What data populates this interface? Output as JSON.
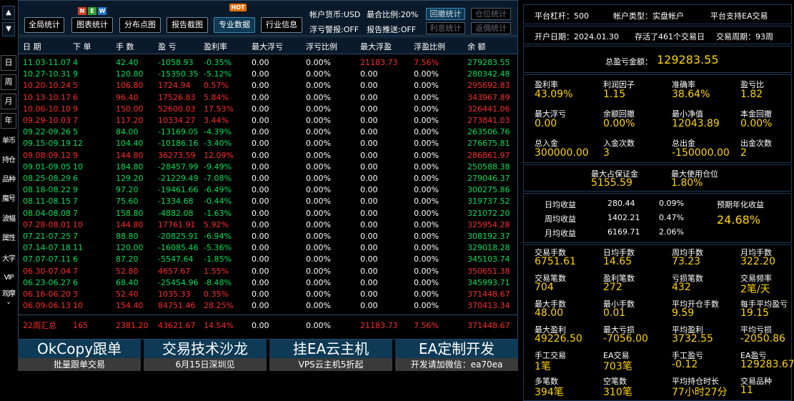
{
  "nav": {
    "up_arrow": "▲",
    "down_arrow": "▼",
    "side": [
      "日",
      "周",
      "月",
      "年",
      "单币",
      "持仓",
      "品种",
      "魔号",
      "波幅",
      "属性",
      "大字",
      "VIP",
      "观摩",
      "˅"
    ]
  },
  "toolbar": {
    "buttons": [
      "全局统计",
      "图表统计",
      "分布点图",
      "报告截图",
      "专业数据",
      "行业信息"
    ],
    "badges": [
      "N",
      "E",
      "W"
    ],
    "hot_badge": "HOT",
    "currency": "帐户货币:USD",
    "max_ratio": "最合比例:20%",
    "float_alert": "浮亏警报:OFF",
    "report_push": "报告推送:OFF",
    "btn_drawdown": "回撤统计",
    "btn_position": "仓位统计",
    "btn_interest": "利息统计",
    "btn_rebate": "返佣统计"
  },
  "table": {
    "headers": [
      "日 期",
      "下 单",
      "手 数",
      "盈 亏",
      "盈利率",
      "最大浮亏",
      "浮亏比例",
      "最大浮盈",
      "浮盈比例",
      "余 额"
    ],
    "rows": [
      {
        "c": "green",
        "d": [
          "11.03-11.07",
          "4",
          "42.40",
          "-1058.93",
          "-0.35%",
          "0.00",
          "0.00%",
          "21183.73",
          "7.56%",
          "279283.55"
        ]
      },
      {
        "c": "green",
        "d": [
          "10.27-10.31",
          "9",
          "120.80",
          "-15350.35",
          "-5.12%",
          "0.00",
          "0.00%",
          "0.00",
          "0.00%",
          "280342.48"
        ]
      },
      {
        "c": "red",
        "d": [
          "10.20-10.24",
          "5",
          "106.80",
          "1724.94",
          "0.57%",
          "0.00",
          "0.00%",
          "0.00",
          "0.00%",
          "295692.83"
        ]
      },
      {
        "c": "red",
        "d": [
          "10.13-10.17",
          "6",
          "96.40",
          "17526.83",
          "5.84%",
          "0.00",
          "0.00%",
          "0.00",
          "0.00%",
          "343967.89"
        ]
      },
      {
        "c": "red",
        "d": [
          "10.06-10.10",
          "9",
          "150.00",
          "52600.03",
          "17.53%",
          "0.00",
          "0.00%",
          "0.00",
          "0.00%",
          "326441.06"
        ]
      },
      {
        "c": "red",
        "d": [
          "09.29-10.03",
          "7",
          "117.20",
          "10334.27",
          "3.44%",
          "0.00",
          "0.00%",
          "0.00",
          "0.00%",
          "273841.03"
        ]
      },
      {
        "c": "green",
        "d": [
          "09.22-09.26",
          "5",
          "84.00",
          "-13169.05",
          "-4.39%",
          "0.00",
          "0.00%",
          "0.00",
          "0.00%",
          "263506.76"
        ]
      },
      {
        "c": "green",
        "d": [
          "09.15-09.19",
          "12",
          "104.40",
          "-10186.16",
          "-3.40%",
          "0.00",
          "0.00%",
          "0.00",
          "0.00%",
          "276675.81"
        ]
      },
      {
        "c": "red",
        "d": [
          "09.08-09.12",
          "9",
          "144.80",
          "36273.59",
          "12.09%",
          "0.00",
          "0.00%",
          "0.00",
          "0.00%",
          "286861.97"
        ]
      },
      {
        "c": "green",
        "d": [
          "09.01-09.05",
          "10",
          "184.80",
          "-28457.99",
          "-9.49%",
          "0.00",
          "0.00%",
          "0.00",
          "0.00%",
          "250588.38"
        ]
      },
      {
        "c": "green",
        "d": [
          "08.25-08.29",
          "6",
          "129.20",
          "-21229.49",
          "-7.08%",
          "0.00",
          "0.00%",
          "0.00",
          "0.00%",
          "279046.37"
        ]
      },
      {
        "c": "green",
        "d": [
          "08.18-08.22",
          "9",
          "97.20",
          "-19461.66",
          "-6.49%",
          "0.00",
          "0.00%",
          "0.00",
          "0.00%",
          "300275.86"
        ]
      },
      {
        "c": "green",
        "d": [
          "08.11-08.15",
          "7",
          "75.60",
          "-1334.68",
          "-0.44%",
          "0.00",
          "0.00%",
          "0.00",
          "0.00%",
          "319737.52"
        ]
      },
      {
        "c": "green",
        "d": [
          "08.04-08.08",
          "7",
          "158.80",
          "-4882.08",
          "-1.63%",
          "0.00",
          "0.00%",
          "0.00",
          "0.00%",
          "321072.20"
        ]
      },
      {
        "c": "red",
        "d": [
          "07.28-08.01",
          "10",
          "144.80",
          "17761.91",
          "5.92%",
          "0.00",
          "0.00%",
          "0.00",
          "0.00%",
          "325954.28"
        ]
      },
      {
        "c": "green",
        "d": [
          "07.21-07.25",
          "7",
          "88.80",
          "-20825.91",
          "-6.94%",
          "0.00",
          "0.00%",
          "0.00",
          "0.00%",
          "308192.37"
        ]
      },
      {
        "c": "green",
        "d": [
          "07.14-07.18",
          "11",
          "120.00",
          "-16085.46",
          "-5.36%",
          "0.00",
          "0.00%",
          "0.00",
          "0.00%",
          "329018.28"
        ]
      },
      {
        "c": "green",
        "d": [
          "07.07-07.11",
          "6",
          "87.20",
          "-5547.64",
          "-1.85%",
          "0.00",
          "0.00%",
          "0.00",
          "0.00%",
          "345103.74"
        ]
      },
      {
        "c": "red",
        "d": [
          "06.30-07.04",
          "7",
          "52.80",
          "4657.67",
          "1.55%",
          "0.00",
          "0.00%",
          "0.00",
          "0.00%",
          "350651.38"
        ]
      },
      {
        "c": "green",
        "d": [
          "06.23-06.27",
          "6",
          "68.40",
          "-25454.96",
          "-8.48%",
          "0.00",
          "0.00%",
          "0.00",
          "0.00%",
          "345993.71"
        ]
      },
      {
        "c": "red",
        "d": [
          "06.16-06.20",
          "3",
          "52.40",
          "1035.33",
          "0.35%",
          "0.00",
          "0.00%",
          "0.00",
          "0.00%",
          "371448.67"
        ]
      },
      {
        "c": "red",
        "d": [
          "06.09-06.13",
          "10",
          "154.40",
          "84751.46",
          "28.25%",
          "0.00",
          "0.00%",
          "0.00",
          "0.00%",
          "370413.34"
        ]
      }
    ],
    "summary": [
      "22周汇总",
      "165",
      "2381.20",
      "43621.67",
      "14.54%",
      "0.00",
      "0.00%",
      "21183.73",
      "7.56%",
      "371448.67"
    ]
  },
  "banners": [
    {
      "title": "OkCopy跟单",
      "sub": "批量跟单交易"
    },
    {
      "title": "交易技术沙龙",
      "sub": "6月15日深圳见"
    },
    {
      "title": "挂EA云主机",
      "sub": "VPS云主机5折起"
    },
    {
      "title": "EA定制开发",
      "sub": "开发请加微信：ea70ea"
    }
  ],
  "right": {
    "leverage": "平台杠杆：500",
    "account_type": "帐户类型：实盘帐户",
    "ea_support": "平台支持EA交易",
    "open_date": "开户日期：2024.01.30",
    "survived": "存活了461个交易日",
    "period": "交易周期：93周",
    "total_label": "总盈亏金额：",
    "total_value": "129283.55",
    "stats1": [
      {
        "l": "盈利率",
        "v": "43.09%"
      },
      {
        "l": "利润因子",
        "v": "1.15"
      },
      {
        "l": "准确率",
        "v": "38.64%"
      },
      {
        "l": "盈亏比",
        "v": "1.82"
      },
      {
        "l": "最大浮亏",
        "v": "0.00"
      },
      {
        "l": "余额回撤",
        "v": "0.00%"
      },
      {
        "l": "最小净值",
        "v": "12043.89"
      },
      {
        "l": "本金回撤",
        "v": "0.00%"
      },
      {
        "l": "总入金",
        "v": "300000.00"
      },
      {
        "l": "入金次数",
        "v": "3"
      },
      {
        "l": "总出金",
        "v": "-150000.00"
      },
      {
        "l": "出金次数",
        "v": "2"
      }
    ],
    "margin_label": "最大占保证金",
    "margin_value": "5155.59",
    "maxpos_label": "最大使用仓位",
    "maxpos_value": "1.80%",
    "income": [
      {
        "l": "日均收益",
        "a": "280.44",
        "p": "0.09%"
      },
      {
        "l": "周均收益",
        "a": "1402.21",
        "p": "0.47%"
      },
      {
        "l": "月均收益",
        "a": "6169.71",
        "p": "2.06%"
      }
    ],
    "annual_label": "预期年化收益",
    "annual_value": "24.68%",
    "stats2": [
      {
        "l": "交易手数",
        "v": "6751.61"
      },
      {
        "l": "日均手数",
        "v": "14.65"
      },
      {
        "l": "周均手数",
        "v": "73.23"
      },
      {
        "l": "月均手数",
        "v": "322.20"
      },
      {
        "l": "交易笔数",
        "v": "704"
      },
      {
        "l": "盈利笔数",
        "v": "272"
      },
      {
        "l": "亏损笔数",
        "v": "432"
      },
      {
        "l": "交易频率",
        "v": "2笔/天"
      },
      {
        "l": "最大手数",
        "v": "48.00"
      },
      {
        "l": "最小手数",
        "v": "0.01"
      },
      {
        "l": "平均开仓手数",
        "v": "9.59"
      },
      {
        "l": "每手平均盈亏",
        "v": "19.15"
      },
      {
        "l": "最大盈利",
        "v": "49226.50"
      },
      {
        "l": "最大亏损",
        "v": "-7056.00"
      },
      {
        "l": "平均盈利",
        "v": "3732.55"
      },
      {
        "l": "平均亏损",
        "v": "-2050.86"
      },
      {
        "l": "手工交易",
        "v": "1笔"
      },
      {
        "l": "EA交易",
        "v": "703笔"
      },
      {
        "l": "手工盈亏",
        "v": "-0.12"
      },
      {
        "l": "EA盈亏",
        "v": "129283.67"
      },
      {
        "l": "多笔数",
        "v": "394笔"
      },
      {
        "l": "空笔数",
        "v": "310笔"
      },
      {
        "l": "平均持仓时长",
        "v": "77小时27分"
      },
      {
        "l": "交易品种",
        "v": "11"
      }
    ]
  }
}
